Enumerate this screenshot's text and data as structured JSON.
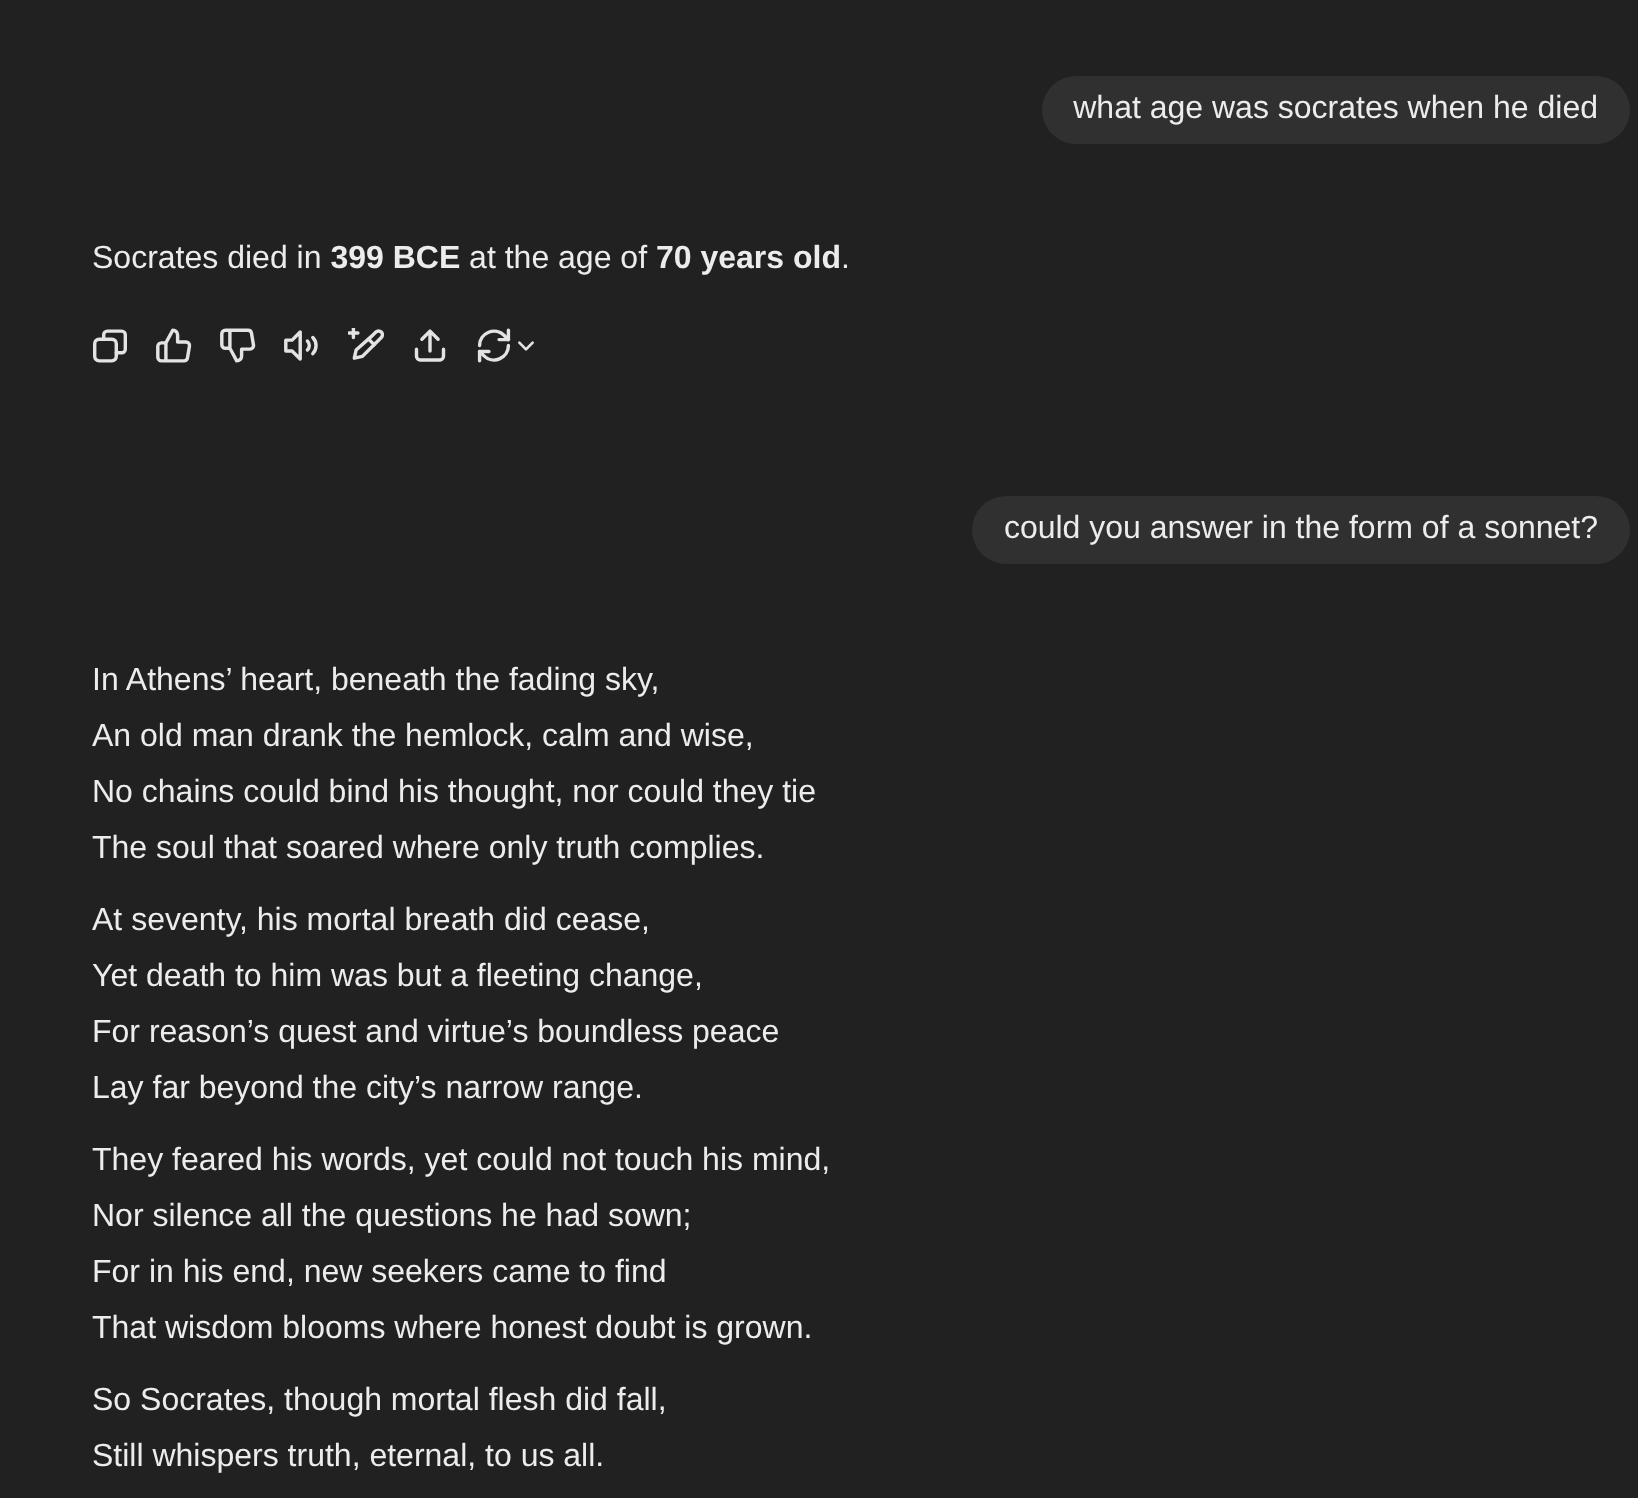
{
  "conversation": [
    {
      "kind": "user",
      "text": "what age was socrates when he died"
    },
    {
      "kind": "assistant",
      "text": "Socrates died in **399 BCE** at the age of **70 years old**.",
      "actions": [
        {
          "kind": "copy"
        },
        {
          "kind": "like"
        },
        {
          "kind": "dislike"
        },
        {
          "kind": "read_aloud"
        },
        {
          "kind": "edit"
        },
        {
          "kind": "share"
        },
        {
          "kind": "regenerate"
        }
      ]
    },
    {
      "kind": "user",
      "text": "could you answer in the form of a sonnet?"
    },
    {
      "kind": "assistant",
      "stanzas": [
        [
          "In Athens’ heart, beneath the fading sky,",
          "An old man drank the hemlock, calm and wise,",
          "No chains could bind his thought, nor could they tie",
          "The soul that soared where only truth complies."
        ],
        [
          "At seventy, his mortal breath did cease,",
          "Yet death to him was but a fleeting change,",
          "For reason’s quest and virtue’s boundless peace",
          "Lay far beyond the city’s narrow range."
        ],
        [
          "They feared his words, yet could not touch his mind,",
          "Nor silence all the questions he had sown;",
          "For in his end, new seekers came to find",
          "That wisdom blooms where honest doubt is grown."
        ],
        [
          "So Socrates, though mortal flesh did fall,",
          "Still whispers truth, eternal, to us all."
        ]
      ]
    }
  ]
}
